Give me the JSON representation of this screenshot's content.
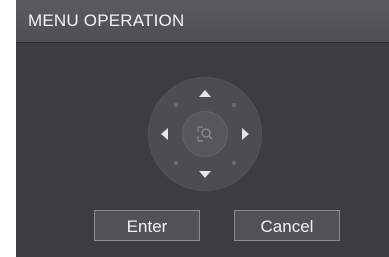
{
  "dialog": {
    "title": "MENU OPERATION",
    "enter_label": "Enter",
    "cancel_label": "Cancel"
  },
  "icons": {
    "up": "arrow-up-icon",
    "down": "arrow-down-icon",
    "left": "arrow-left-icon",
    "right": "arrow-right-icon",
    "center": "zoom-icon"
  }
}
